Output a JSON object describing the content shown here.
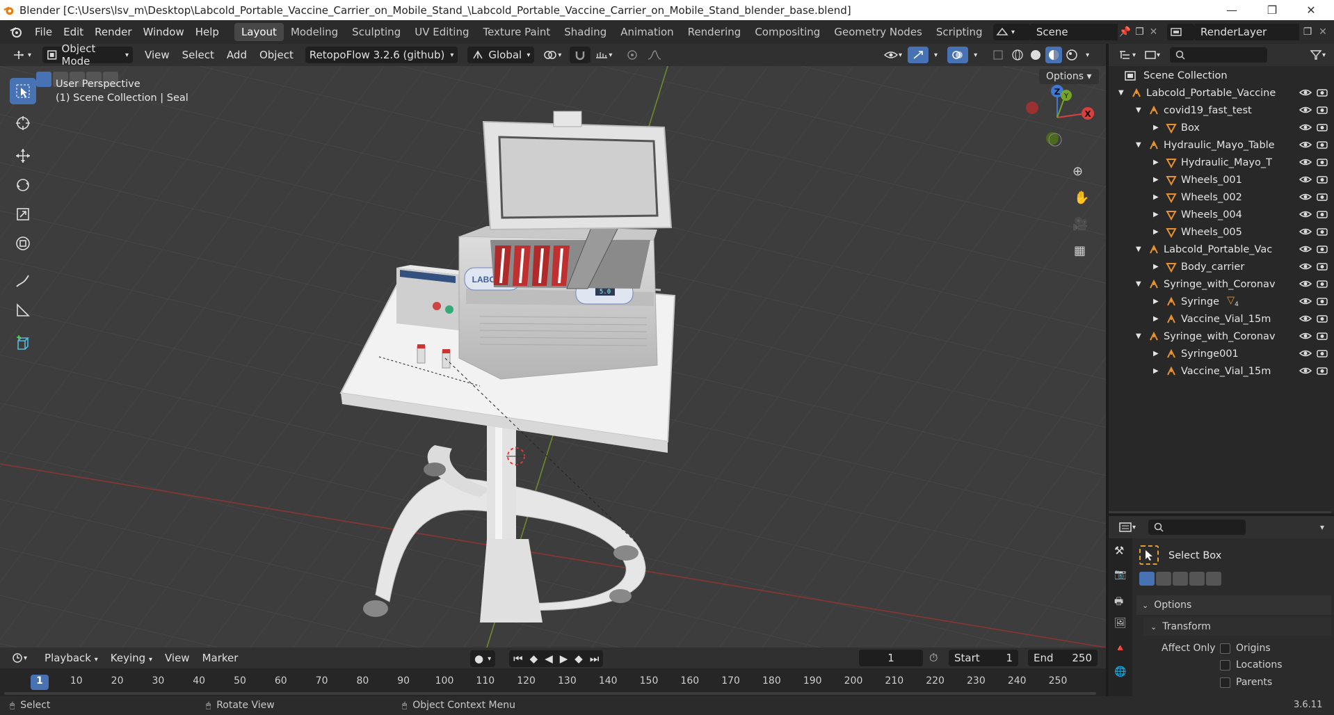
{
  "window": {
    "title": "Blender [C:\\Users\\lsv_m\\Desktop\\Labcold_Portable_Vaccine_Carrier_on_Mobile_Stand_\\Labcold_Portable_Vaccine_Carrier_on_Mobile_Stand_blender_base.blend]",
    "minimize": "—",
    "maximize": "❐",
    "close": "✕"
  },
  "menu": [
    "File",
    "Edit",
    "Render",
    "Window",
    "Help"
  ],
  "workspaces": [
    "Layout",
    "Modeling",
    "Sculpting",
    "UV Editing",
    "Texture Paint",
    "Shading",
    "Animation",
    "Rendering",
    "Compositing",
    "Geometry Nodes",
    "Scripting"
  ],
  "active_workspace": "Layout",
  "add_workspace": "+",
  "scene": {
    "label": "Scene",
    "render_layer": "RenderLayer"
  },
  "viewport_header": {
    "mode": "Object Mode",
    "menus": [
      "View",
      "Select",
      "Add",
      "Object"
    ],
    "addon": "RetopoFlow 3.2.6 (github)",
    "orientation": "Global",
    "options": "Options"
  },
  "viewport": {
    "perspective": "User Perspective",
    "collection_info": "(1) Scene Collection | Seal",
    "gizmo": {
      "z": "Z",
      "x": "X",
      "y": "Y"
    },
    "carrier_brand": "LABCOLD",
    "display_reading": "5.0"
  },
  "outliner": {
    "root": "Scene Collection",
    "items": [
      {
        "label": "Labcold_Portable_Vaccine",
        "depth": 0,
        "kind": "collection",
        "expanded": true
      },
      {
        "label": "covid19_fast_test",
        "depth": 1,
        "kind": "collection",
        "expanded": true
      },
      {
        "label": "Box",
        "depth": 2,
        "kind": "mesh",
        "expanded": false
      },
      {
        "label": "Hydraulic_Mayo_Table",
        "depth": 1,
        "kind": "collection",
        "expanded": true
      },
      {
        "label": "Hydraulic_Mayo_T",
        "depth": 2,
        "kind": "mesh",
        "expanded": false
      },
      {
        "label": "Wheels_001",
        "depth": 2,
        "kind": "mesh",
        "expanded": false
      },
      {
        "label": "Wheels_002",
        "depth": 2,
        "kind": "mesh",
        "expanded": false
      },
      {
        "label": "Wheels_004",
        "depth": 2,
        "kind": "mesh",
        "expanded": false
      },
      {
        "label": "Wheels_005",
        "depth": 2,
        "kind": "mesh",
        "expanded": false
      },
      {
        "label": "Labcold_Portable_Vac",
        "depth": 1,
        "kind": "collection",
        "expanded": true
      },
      {
        "label": "Body_carrier",
        "depth": 2,
        "kind": "mesh",
        "expanded": false
      },
      {
        "label": "Syringe_with_Coronav",
        "depth": 1,
        "kind": "collection",
        "expanded": true
      },
      {
        "label": "Syringe",
        "depth": 2,
        "kind": "empty",
        "expanded": false
      },
      {
        "label": "Vaccine_Vial_15m",
        "depth": 2,
        "kind": "empty",
        "expanded": false
      },
      {
        "label": "Syringe_with_Coronav",
        "depth": 1,
        "kind": "collection",
        "expanded": true
      },
      {
        "label": "Syringe001",
        "depth": 2,
        "kind": "empty",
        "expanded": false
      },
      {
        "label": "Vaccine_Vial_15m",
        "depth": 2,
        "kind": "empty",
        "expanded": false
      }
    ],
    "syringe_badge": "4"
  },
  "properties": {
    "tool": "Select Box",
    "options": "Options",
    "transform": "Transform",
    "affect_only": "Affect Only",
    "checks": [
      "Origins",
      "Locations",
      "Parents"
    ]
  },
  "timeline": {
    "menus": [
      "Playback",
      "Keying",
      "View",
      "Marker"
    ],
    "current_frame": "1",
    "start_label": "Start",
    "start": "1",
    "end_label": "End",
    "end": "250",
    "ticks": [
      "1",
      "10",
      "20",
      "30",
      "40",
      "50",
      "60",
      "70",
      "80",
      "90",
      "100",
      "110",
      "120",
      "130",
      "140",
      "150",
      "160",
      "170",
      "180",
      "190",
      "200",
      "210",
      "220",
      "230",
      "240",
      "250"
    ]
  },
  "status": {
    "select": "Select",
    "rotate": "Rotate View",
    "context": "Object Context Menu",
    "version": "3.6.11"
  }
}
